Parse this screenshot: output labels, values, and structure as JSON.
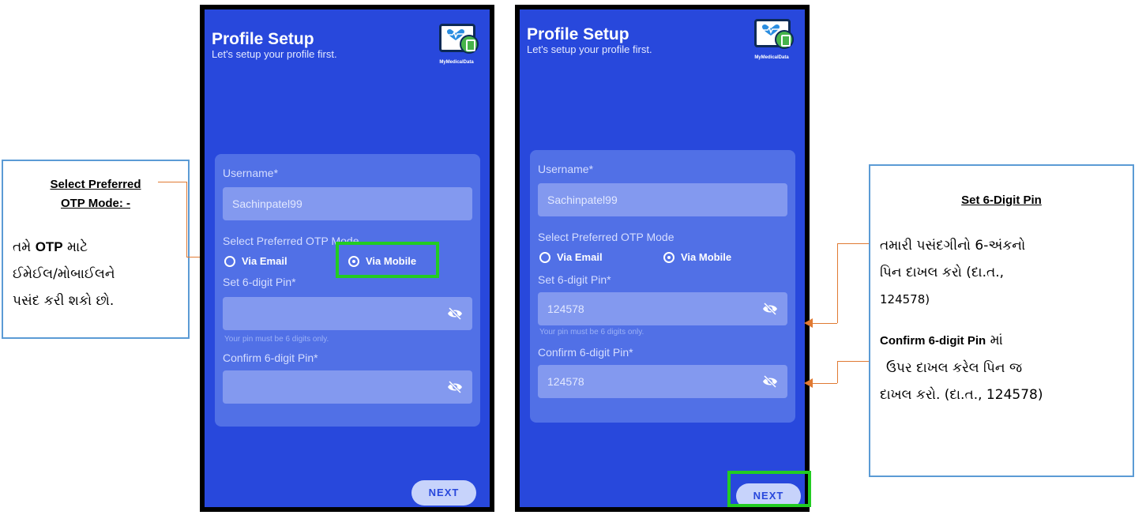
{
  "screen": {
    "title": "Profile Setup",
    "subtitle": "Let's setup your profile first.",
    "brand": "MyMedicalData",
    "username_label": "Username*",
    "username_value": "Sachinpatel99",
    "otp_label": "Select Preferred OTP Mode",
    "otp_options": [
      "Via Email",
      "Via Mobile"
    ],
    "otp_selected": "Via Mobile",
    "pin_label": "Set 6-digit Pin*",
    "pin_hint": "Your pin must be 6 digits only.",
    "confirm_label": "Confirm 6-digit Pin*",
    "next_label": "NEXT",
    "pin_value_filled": "124578",
    "confirm_value_filled": "124578"
  },
  "callouts": {
    "left": {
      "title_line1": "Select Preferred",
      "title_line2": "OTP Mode: -",
      "body_line1_pre": "તમે ",
      "body_line1_bold": "OTP",
      "body_line1_post": " માટે",
      "body_line2": "ઈમેઈલ/મોબાઈલને",
      "body_line3": "પસંદ કરી શકો છો."
    },
    "right": {
      "title": "Set 6-Digit Pin",
      "body_line1": "તમારી પસંદગીનો 6-અંકનો",
      "body_line2": "પિન દાખલ કરો (દા.ત.,",
      "body_line3": "124578)",
      "body_line4_bold": "Confirm 6-digit Pin",
      "body_line4_post": " માં",
      "body_line5": "ઉપર દાખલ કરેલ પિન જ",
      "body_line6": "દાખલ કરો. (દા.ત., 124578)"
    }
  },
  "colors": {
    "screen_bg": "#2848dc",
    "card_bg": "#5170e6",
    "field_bg": "#8399ef",
    "highlight": "#22cc22",
    "connector": "#e07a33",
    "callout_border": "#5b9bd5"
  }
}
